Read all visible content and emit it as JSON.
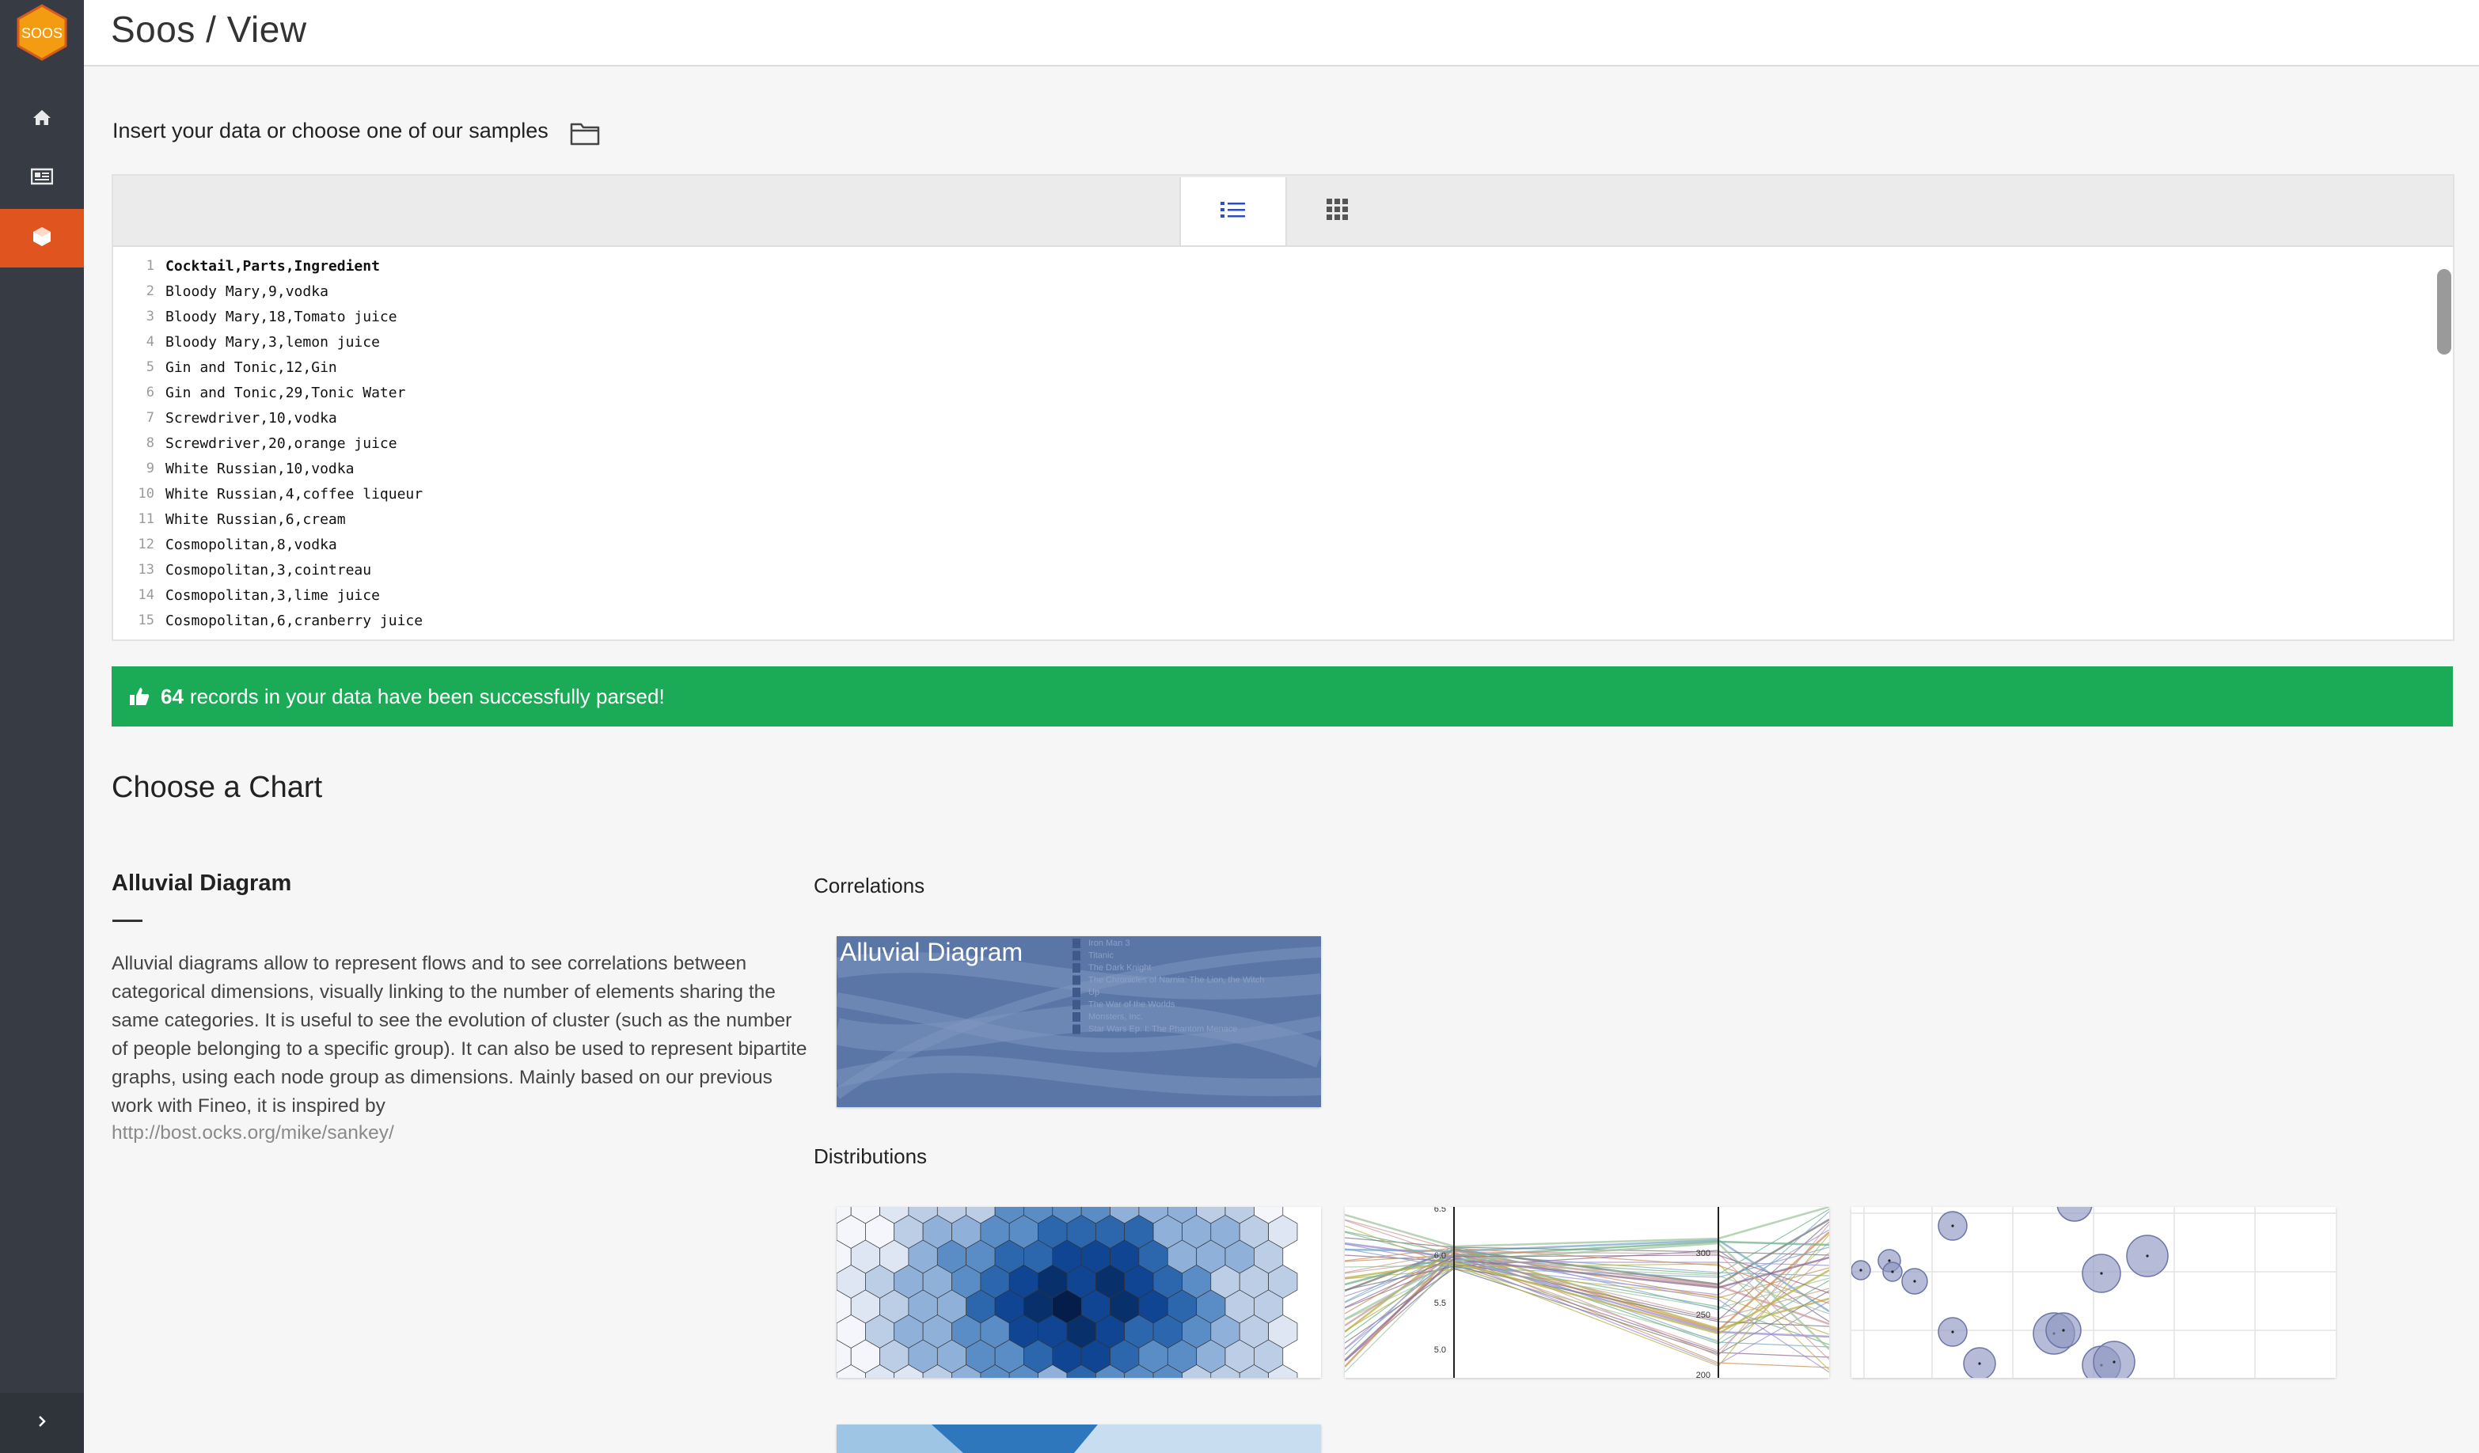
{
  "app": {
    "logo_text": "SOOS",
    "page_title": "Soos / View"
  },
  "sidebar": {
    "items": [
      {
        "icon": "home-icon"
      },
      {
        "icon": "news-icon"
      },
      {
        "icon": "cube-icon",
        "active": true
      }
    ],
    "expand_icon": "chevron-right-icon"
  },
  "data_input": {
    "prompt": "Insert your data or choose one of our samples",
    "folder_icon": "folder-icon",
    "view_modes": [
      {
        "icon": "list-icon",
        "active": true
      },
      {
        "icon": "grid-icon",
        "active": false
      }
    ],
    "lines": [
      {
        "n": "1",
        "text": "Cocktail,Parts,Ingredient"
      },
      {
        "n": "2",
        "text": "Bloody Mary,9,vodka"
      },
      {
        "n": "3",
        "text": "Bloody Mary,18,Tomato juice"
      },
      {
        "n": "4",
        "text": "Bloody Mary,3,lemon juice"
      },
      {
        "n": "5",
        "text": "Gin and Tonic,12,Gin"
      },
      {
        "n": "6",
        "text": "Gin and Tonic,29,Tonic Water"
      },
      {
        "n": "7",
        "text": "Screwdriver,10,vodka"
      },
      {
        "n": "8",
        "text": "Screwdriver,20,orange juice"
      },
      {
        "n": "9",
        "text": "White Russian,10,vodka"
      },
      {
        "n": "10",
        "text": "White Russian,4,coffee liqueur"
      },
      {
        "n": "11",
        "text": "White Russian,6,cream"
      },
      {
        "n": "12",
        "text": "Cosmopolitan,8,vodka"
      },
      {
        "n": "13",
        "text": "Cosmopolitan,3,cointreau"
      },
      {
        "n": "14",
        "text": "Cosmopolitan,3,lime juice"
      },
      {
        "n": "15",
        "text": "Cosmopolitan,6,cranberry juice"
      }
    ]
  },
  "status": {
    "count": "64",
    "message": "records in your data have been successfully parsed!",
    "color": "#1bab57"
  },
  "chooser": {
    "title": "Choose a Chart",
    "selected": {
      "name": "Alluvial Diagram",
      "description": "Alluvial diagrams allow to represent flows and to see correlations between categorical dimensions, visually linking to the number of elements sharing the same categories. It is useful to see the evolution of cluster (such as the number of people belonging to a specific group). It can also be used to represent bipartite graphs, using each node group as dimensions. Mainly based on our previous work with Fineo, it is inspired by",
      "link": "http://bost.ocks.org/mike/sankey/"
    },
    "categories": [
      {
        "label": "Correlations",
        "charts": [
          {
            "title": "Alluvial Diagram",
            "legend": [
              "Iron Man 3",
              "Titanic",
              "The Dark Knight",
              "The Chronicles of Narnia: The Lion, the Witch",
              "Up",
              "The War of the Worlds",
              "Monsters, Inc.",
              "Star Wars Ep. I: The Phantom Menace"
            ]
          }
        ]
      },
      {
        "label": "Distributions",
        "charts": [
          {
            "kind": "hexbin"
          },
          {
            "kind": "parallel-coordinates",
            "axis_labels": [
              "6.5",
              "6.0",
              "5.5",
              "5.0",
              "300",
              "250",
              "200"
            ]
          },
          {
            "kind": "bubble"
          },
          {
            "kind": "partial"
          }
        ]
      }
    ]
  },
  "colors": {
    "sidebar": "#373c44",
    "accent": "#e0541f",
    "success": "#1bab57"
  }
}
